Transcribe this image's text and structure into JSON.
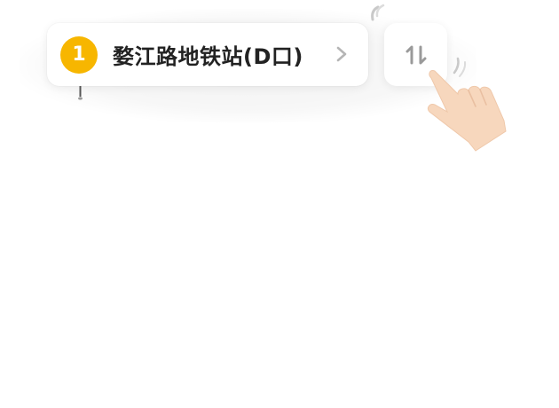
{
  "route_card": {
    "badge_number": "1",
    "station_name": "婺江路地铁站(D口)"
  },
  "icons": {
    "chevron": "chevron-right-icon",
    "swap": "swap-vertical-icon",
    "pin": "location-pin-icon",
    "hand": "tapping-hand-icon"
  },
  "colors": {
    "badge": "#f7b600",
    "station_text": "#222222",
    "icon_gray": "#9a9a9a",
    "hand_skin": "#f7d7bd"
  }
}
